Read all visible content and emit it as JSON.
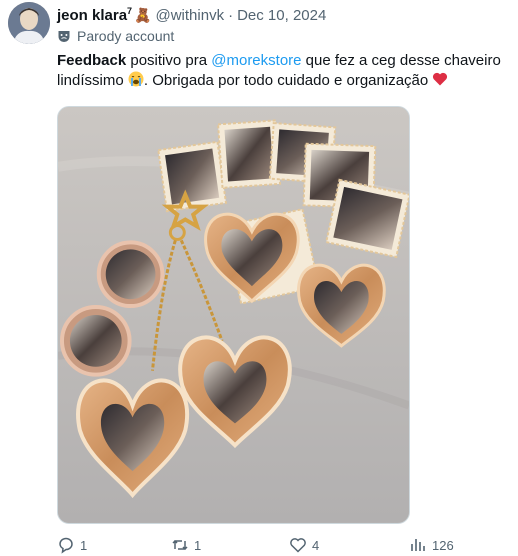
{
  "tweet": {
    "display_name": "jeon klara",
    "name_superscript": "7",
    "bear_emoji": "🧸",
    "handle": "@withinvk",
    "separator": "·",
    "date": "Dec 10, 2024",
    "parody_label": "Parody account",
    "text": {
      "bold_word": "Feedback",
      "part1": " positivo pra ",
      "mention": "@morekstore",
      "part2": " que fez a ceg desse chaveiro lindíssimo ",
      "part3": ". Obrigada por todo cuidado e organização "
    },
    "icons": {
      "crying_emoji": "loudly-crying-face-icon",
      "heart_emoji": "red-heart-icon"
    }
  },
  "actions": {
    "replies": "1",
    "retweets": "1",
    "likes": "4",
    "views": "126"
  },
  "colors": {
    "link": "#1d9bf0",
    "secondary": "#536471",
    "text": "#0f1419"
  }
}
